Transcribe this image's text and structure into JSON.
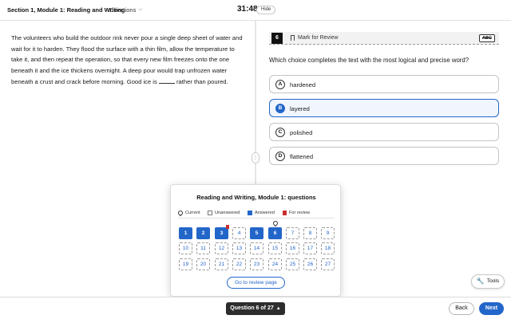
{
  "header": {
    "section_title": "Section 1, Module 1: Reading and Writing",
    "directions_label": "Directions",
    "timer": "31:48",
    "hide_label": "Hide"
  },
  "passage": {
    "before_blank": "The volunteers who build the outdoor rink never pour a single deep sheet of water and wait for it to harden. They flood the surface with a thin film, allow the temperature to take it, and then repeat the operation, so that every new film freezes onto the one beneath it and the ice thickens overnight. A deep pour would trap unfrozen water beneath a crust and crack before morning. Good ice is",
    "after_blank": "rather than poured."
  },
  "question": {
    "number": "6",
    "mark_for_review": "Mark for Review",
    "abc_label": "ABC",
    "prompt": "Which choice completes the text with the most logical and precise word?",
    "choices": [
      {
        "letter": "A",
        "text": "hardened",
        "selected": false
      },
      {
        "letter": "B",
        "text": "layered",
        "selected": true
      },
      {
        "letter": "C",
        "text": "polished",
        "selected": false
      },
      {
        "letter": "D",
        "text": "flattened",
        "selected": false
      }
    ]
  },
  "navigator": {
    "title": "Reading and Writing, Module 1: questions",
    "legend": {
      "current": "Current",
      "unanswered": "Unanswered",
      "answered": "Answered",
      "for_review": "For review"
    },
    "questions": [
      {
        "n": "1",
        "answered": true,
        "review": false,
        "current": false
      },
      {
        "n": "2",
        "answered": true,
        "review": false,
        "current": false
      },
      {
        "n": "3",
        "answered": true,
        "review": true,
        "current": false
      },
      {
        "n": "4",
        "answered": false,
        "review": false,
        "current": false
      },
      {
        "n": "5",
        "answered": true,
        "review": false,
        "current": false
      },
      {
        "n": "6",
        "answered": true,
        "review": false,
        "current": true
      },
      {
        "n": "7",
        "answered": false,
        "review": false,
        "current": false
      },
      {
        "n": "8",
        "answered": false,
        "review": false,
        "current": false
      },
      {
        "n": "9",
        "answered": false,
        "review": false,
        "current": false
      },
      {
        "n": "10",
        "answered": false,
        "review": false,
        "current": false
      },
      {
        "n": "11",
        "answered": false,
        "review": false,
        "current": false
      },
      {
        "n": "12",
        "answered": false,
        "review": false,
        "current": false
      },
      {
        "n": "13",
        "answered": false,
        "review": false,
        "current": false
      },
      {
        "n": "14",
        "answered": false,
        "review": false,
        "current": false
      },
      {
        "n": "15",
        "answered": false,
        "review": false,
        "current": false
      },
      {
        "n": "16",
        "answered": false,
        "review": false,
        "current": false
      },
      {
        "n": "17",
        "answered": false,
        "review": false,
        "current": false
      },
      {
        "n": "18",
        "answered": false,
        "review": false,
        "current": false
      },
      {
        "n": "19",
        "answered": false,
        "review": false,
        "current": false
      },
      {
        "n": "20",
        "answered": false,
        "review": false,
        "current": false
      },
      {
        "n": "21",
        "answered": false,
        "review": false,
        "current": false
      },
      {
        "n": "22",
        "answered": false,
        "review": false,
        "current": false
      },
      {
        "n": "23",
        "answered": false,
        "review": false,
        "current": false
      },
      {
        "n": "24",
        "answered": false,
        "review": false,
        "current": false
      },
      {
        "n": "25",
        "answered": false,
        "review": false,
        "current": false
      },
      {
        "n": "26",
        "answered": false,
        "review": false,
        "current": false
      },
      {
        "n": "27",
        "answered": false,
        "review": false,
        "current": false
      }
    ],
    "review_page_button": "Go to review page"
  },
  "footer": {
    "question_indicator": "Question 6 of 27",
    "back_label": "Back",
    "next_label": "Next"
  },
  "tools_label": "Tools",
  "colors": {
    "accent": "#2366c9",
    "review": "#c8302e",
    "dark": "#2d2d2d"
  }
}
